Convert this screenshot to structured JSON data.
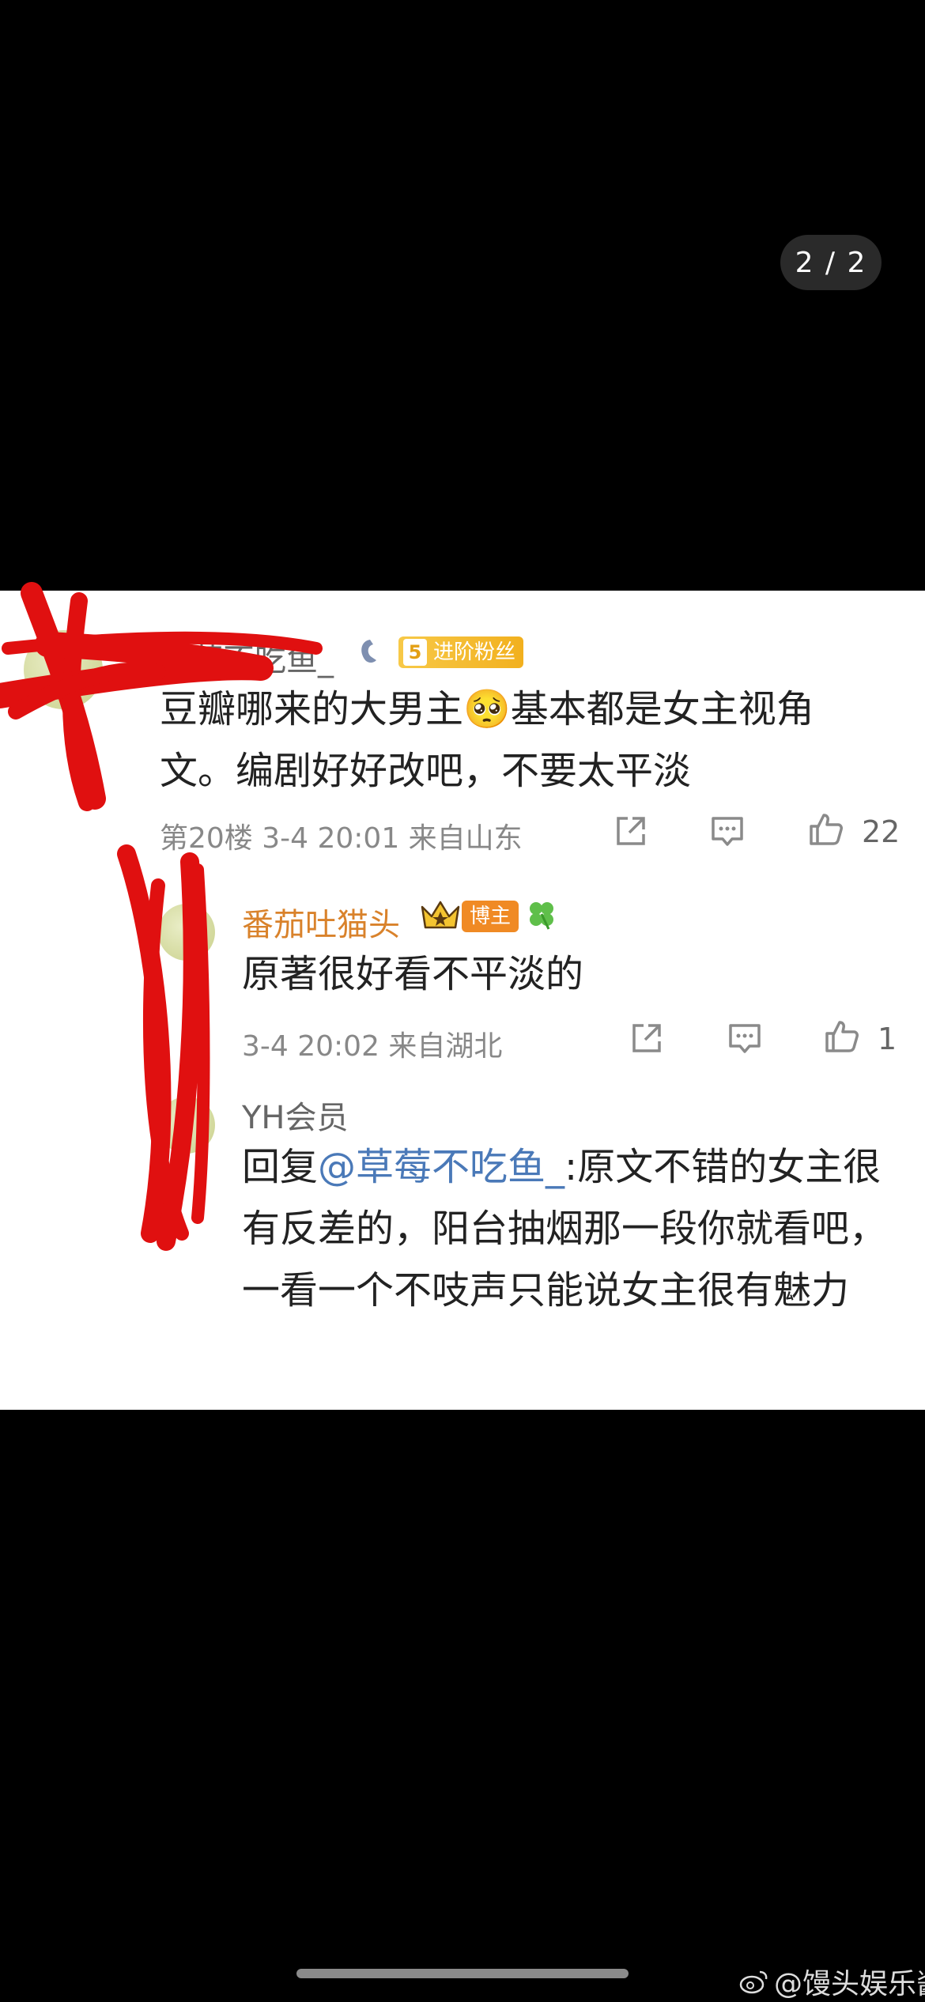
{
  "viewer": {
    "page_indicator": "2 / 2"
  },
  "comments": [
    {
      "username": "草莓不吃鱼_",
      "fan_badge": {
        "level": "5",
        "label": "进阶粉丝"
      },
      "text": "豆瓣哪来的大男主🥺基本都是女主视角文。编剧好好改吧，不要太平淡",
      "meta": "第20楼  3-4 20:01  来自山东",
      "likes": "22"
    },
    {
      "username": "番茄吐猫头",
      "host_badge": "博主",
      "text": "原著很好看不平淡的",
      "meta": "3-4 20:02  来自湖北",
      "likes": "1"
    },
    {
      "username": "YH会员",
      "reply_prefix": "回复",
      "mention": "@草莓不吃鱼_",
      "text": ":原文不错的女主很有反差的，阳台抽烟那一段你就看吧，一看一个不吱声只能说女主很有魅力"
    }
  ],
  "watermark": {
    "label": "@馒头娱乐酱",
    "icon": "weibo-icon"
  },
  "colors": {
    "accent_orange": "#d9822b",
    "mention_blue": "#4a79b8",
    "annotation_red": "#e01010"
  }
}
